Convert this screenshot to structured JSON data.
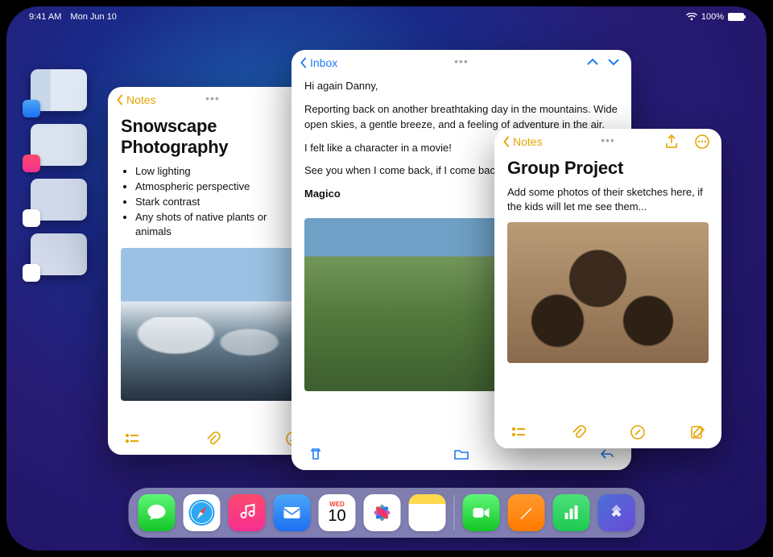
{
  "status": {
    "time": "9:41 AM",
    "date": "Mon Jun 10",
    "battery": "100%"
  },
  "rail": {
    "items": [
      {
        "badge": "mail-icon"
      },
      {
        "badge": "music-icon"
      },
      {
        "badge": "safari-icon"
      },
      {
        "badge": "photos-icon"
      }
    ]
  },
  "notes1": {
    "back": "Notes",
    "title": "Snowscape Photography",
    "bullets": [
      "Low lighting",
      "Atmospheric perspective",
      "Stark contrast",
      "Any shots of native plants or animals"
    ]
  },
  "mail": {
    "back": "Inbox",
    "body": {
      "greeting": "Hi again Danny,",
      "p1": "Reporting back on another breathtaking day in the mountains. Wide open skies, a gentle breeze, and a feeling of adventure in the air.",
      "p2": "I felt like a character in a movie!",
      "p3": "See you when I come back, if I come back. 😢",
      "sig": "Magico"
    }
  },
  "notes2": {
    "back": "Notes",
    "title": "Group Project",
    "sub": "Add some photos of their sketches here, if the kids will let me see them..."
  },
  "dock": {
    "calendar": {
      "month": "WED",
      "day": "10"
    },
    "apps": [
      "messages",
      "safari",
      "music",
      "mail",
      "calendar",
      "photos",
      "notes",
      "facetime",
      "pages",
      "numbers",
      "shortcuts"
    ]
  }
}
